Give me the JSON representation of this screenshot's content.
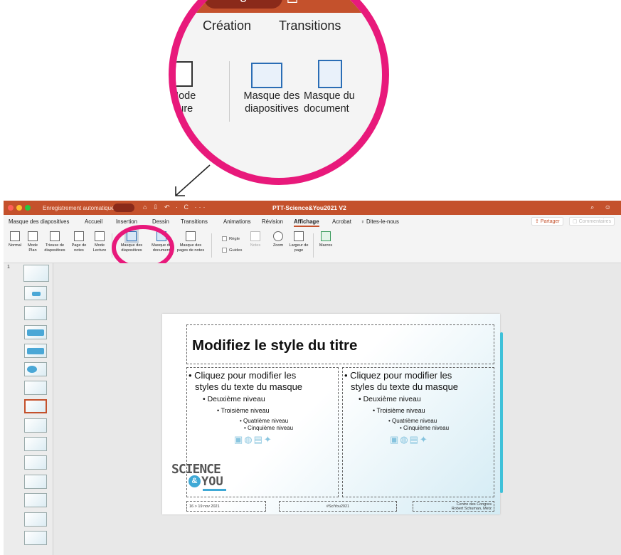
{
  "zoom": {
    "toggle_label": "o",
    "tab_left": "Création",
    "tab_right": "Transitions",
    "btn_left_l1": "Mode",
    "btn_left_l2": "cture",
    "btn_mid_l1": "Masque des",
    "btn_mid_l2": "diapositives",
    "btn_right_l1": "Masque du",
    "btn_right_l2": "document"
  },
  "titlebar": {
    "autosave": "Enregistrement automatique",
    "title": "PTT-Science&You2021 V2",
    "icons": "⌂ ⇩ ↶ · C ···"
  },
  "tabs": [
    "Masque des diapositives",
    "Accueil",
    "Insertion",
    "Dessin",
    "Transitions",
    "Animations",
    "Révision",
    "Affichage",
    "Acrobat"
  ],
  "active_tab": "Affichage",
  "tell_me": "Dites-le-nous",
  "share_label": "Partager",
  "comments_label": "Commentaires",
  "ribbon": {
    "normal": "Normal",
    "plan": "Mode Plan",
    "trieuse": "Trieuse de diapositives",
    "page_notes": "Page de notes",
    "lecture": "Mode Lecture",
    "masque_diapo": "Masque des diapositives",
    "masque_doc": "Masque du document",
    "masque_notes": "Masque des pages de notes",
    "regle": "Règle",
    "guides": "Guides",
    "notes": "Notes",
    "zoom": "Zoom",
    "largeur": "Largeur de page",
    "macros": "Macros"
  },
  "thumbs": {
    "first_number": "1"
  },
  "slide": {
    "title": "Modifiez le style du titre",
    "col1": {
      "l1": "• Cliquez pour modifier les",
      "l1b": "styles du texte du masque",
      "l2": "• Deuxième niveau",
      "l3": "• Troisième niveau",
      "l4": "• Quatrième niveau",
      "l5": "• Cinquième niveau"
    },
    "col2": {
      "l1": "• Cliquez pour modifier les",
      "l1b": "styles du texte du masque",
      "l2": "• Deuxième niveau",
      "l3": "• Troisième niveau",
      "l4": "• Quatrième niveau",
      "l5": "• Cinquième niveau"
    },
    "logo_top": "SCIENCE",
    "logo_amp": "&",
    "logo_bottom": "YOU",
    "footer_date": "16 > 19 nov 2021",
    "footer_tag": "#SciYou2021",
    "footer_place_l1": "Centre des Congres",
    "footer_place_l2": "Robert Schuman, Metz"
  },
  "colors": {
    "accent": "#c4512c",
    "highlight": "#e8197b",
    "slide_bar": "#3fc1d9"
  }
}
